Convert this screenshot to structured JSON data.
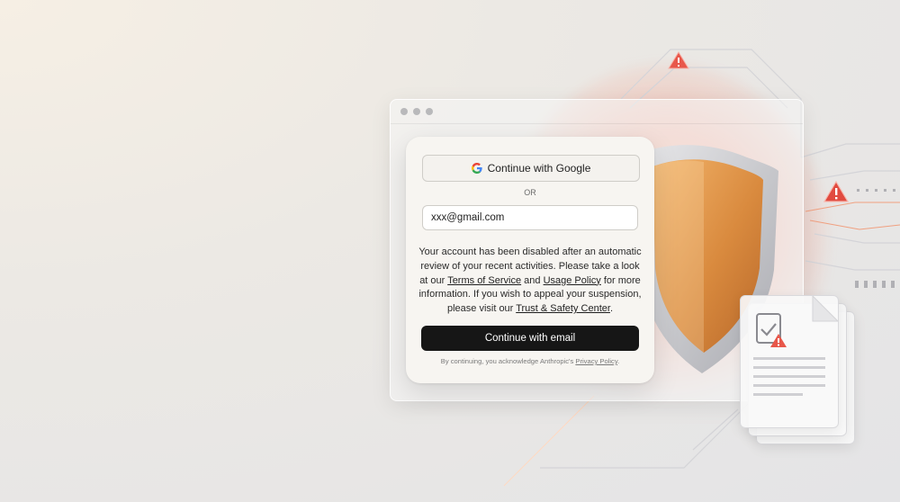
{
  "login": {
    "google_button": "Continue with Google",
    "divider": "OR",
    "email_value": "xxx@gmail.com",
    "message": {
      "part1": "Your account has been disabled after an automatic review of your recent activities. Please take a look at our ",
      "terms_link": "Terms of Service",
      "part2": " and ",
      "usage_link": "Usage Policy",
      "part3": " for more information. If you wish to appeal your suspension, please visit our ",
      "trust_link": "Trust & Safety Center",
      "part4": "."
    },
    "email_button": "Continue with email",
    "footer": {
      "text": "By continuing, you acknowledge Anthropic's ",
      "privacy_link": "Privacy Policy",
      "end": "."
    }
  },
  "icons": {
    "google": "google-icon",
    "shield": "shield-icon",
    "warning": "warning-icon",
    "document": "document-check-icon"
  },
  "colors": {
    "primary_button": "#161616",
    "shield_orange": "#e09a4d",
    "warning_red": "#e8574a"
  }
}
